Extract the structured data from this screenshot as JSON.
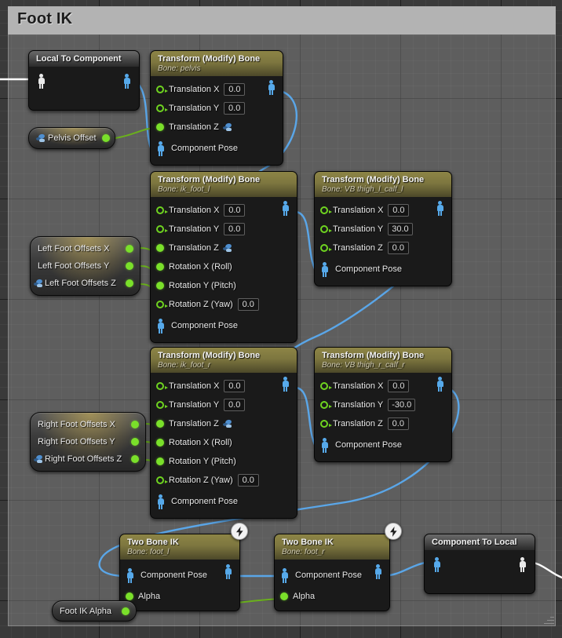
{
  "graph": {
    "comment": {
      "title": "Foot IK"
    },
    "colors": {
      "header_bone": "#7d763f",
      "node_body": "#1a1a1a",
      "pin_data": "#7ae02a",
      "pin_pose_component": "#56a9ea",
      "pin_pose_local": "#e9e9e9",
      "wire_pose": "#5aa6e8",
      "wire_data": "#6ab01c",
      "wire_local_pose": "#ffffff",
      "comment_bar": "#b3b3b3"
    },
    "nodes": [
      {
        "id": "local_to_component",
        "title": "Local To Component",
        "subtitle": "",
        "kind": "plain",
        "rows": []
      },
      {
        "id": "tmb_pelvis",
        "title": "Transform (Modify) Bone",
        "subtitle": "Bone: pelvis",
        "kind": "bone",
        "rows": [
          {
            "label": "Translation X",
            "pin": "hollow",
            "value": "0.0"
          },
          {
            "label": "Translation Y",
            "pin": "hollow",
            "value": "0.0"
          },
          {
            "label": "Translation Z",
            "pin": "filled",
            "value": "",
            "promoted": true
          },
          {
            "label": "Component Pose",
            "pin": "pose"
          }
        ]
      },
      {
        "id": "tmb_ik_foot_l",
        "title": "Transform (Modify) Bone",
        "subtitle": "Bone: ik_foot_l",
        "kind": "bone",
        "rows": [
          {
            "label": "Translation X",
            "pin": "hollow",
            "value": "0.0"
          },
          {
            "label": "Translation Y",
            "pin": "hollow",
            "value": "0.0"
          },
          {
            "label": "Translation Z",
            "pin": "filled",
            "value": "",
            "promoted": true
          },
          {
            "label": "Rotation X (Roll)",
            "pin": "filled",
            "value": ""
          },
          {
            "label": "Rotation Y (Pitch)",
            "pin": "filled",
            "value": ""
          },
          {
            "label": "Rotation Z (Yaw)",
            "pin": "hollow",
            "value": "0.0"
          },
          {
            "label": "Component Pose",
            "pin": "pose"
          }
        ]
      },
      {
        "id": "tmb_vb_thigh_l",
        "title": "Transform (Modify) Bone",
        "subtitle": "Bone: VB thigh_l_calf_l",
        "kind": "bone",
        "rows": [
          {
            "label": "Translation X",
            "pin": "hollow",
            "value": "0.0"
          },
          {
            "label": "Translation Y",
            "pin": "hollow",
            "value": "30.0"
          },
          {
            "label": "Translation Z",
            "pin": "hollow",
            "value": "0.0"
          },
          {
            "label": "Component Pose",
            "pin": "pose"
          }
        ]
      },
      {
        "id": "tmb_ik_foot_r",
        "title": "Transform (Modify) Bone",
        "subtitle": "Bone: ik_foot_r",
        "kind": "bone",
        "rows": [
          {
            "label": "Translation X",
            "pin": "hollow",
            "value": "0.0"
          },
          {
            "label": "Translation Y",
            "pin": "hollow",
            "value": "0.0"
          },
          {
            "label": "Translation Z",
            "pin": "filled",
            "value": "",
            "promoted": true
          },
          {
            "label": "Rotation X (Roll)",
            "pin": "filled",
            "value": ""
          },
          {
            "label": "Rotation Y (Pitch)",
            "pin": "filled",
            "value": ""
          },
          {
            "label": "Rotation Z (Yaw)",
            "pin": "hollow",
            "value": "0.0"
          },
          {
            "label": "Component Pose",
            "pin": "pose"
          }
        ]
      },
      {
        "id": "tmb_vb_thigh_r",
        "title": "Transform (Modify) Bone",
        "subtitle": "Bone: VB thigh_r_calf_r",
        "kind": "bone",
        "rows": [
          {
            "label": "Translation X",
            "pin": "hollow",
            "value": "0.0"
          },
          {
            "label": "Translation Y",
            "pin": "hollow",
            "value": "-30.0"
          },
          {
            "label": "Translation Z",
            "pin": "hollow",
            "value": "0.0"
          },
          {
            "label": "Component Pose",
            "pin": "pose"
          }
        ]
      },
      {
        "id": "two_bone_ik_l",
        "title": "Two Bone IK",
        "subtitle": "Bone: foot_l",
        "kind": "bone",
        "badge": "fast-path",
        "rows": [
          {
            "label": "Component Pose",
            "pin": "pose"
          },
          {
            "label": "Alpha",
            "pin": "filled",
            "value": ""
          }
        ]
      },
      {
        "id": "two_bone_ik_r",
        "title": "Two Bone IK",
        "subtitle": "Bone: foot_r",
        "kind": "bone",
        "badge": "fast-path",
        "rows": [
          {
            "label": "Component Pose",
            "pin": "pose"
          },
          {
            "label": "Alpha",
            "pin": "filled",
            "value": ""
          }
        ]
      },
      {
        "id": "component_to_local",
        "title": "Component To Local",
        "subtitle": "",
        "kind": "plain",
        "rows": []
      }
    ],
    "variables": [
      {
        "id": "pelvis_offset",
        "pins": [
          {
            "label": "Pelvis Offset",
            "promoted": true
          }
        ]
      },
      {
        "id": "left_foot_offsets",
        "pins": [
          {
            "label": "Left Foot Offsets X",
            "promoted": false
          },
          {
            "label": "Left Foot Offsets Y",
            "promoted": false
          },
          {
            "label": "Left Foot Offsets Z",
            "promoted": true
          }
        ]
      },
      {
        "id": "right_foot_offsets",
        "pins": [
          {
            "label": "Right Foot Offsets X",
            "promoted": false
          },
          {
            "label": "Right Foot Offsets Y",
            "promoted": false
          },
          {
            "label": "Right Foot Offsets Z",
            "promoted": true
          }
        ]
      },
      {
        "id": "foot_ik_alpha",
        "pins": [
          {
            "label": "Foot IK Alpha",
            "promoted": false
          }
        ]
      }
    ]
  }
}
